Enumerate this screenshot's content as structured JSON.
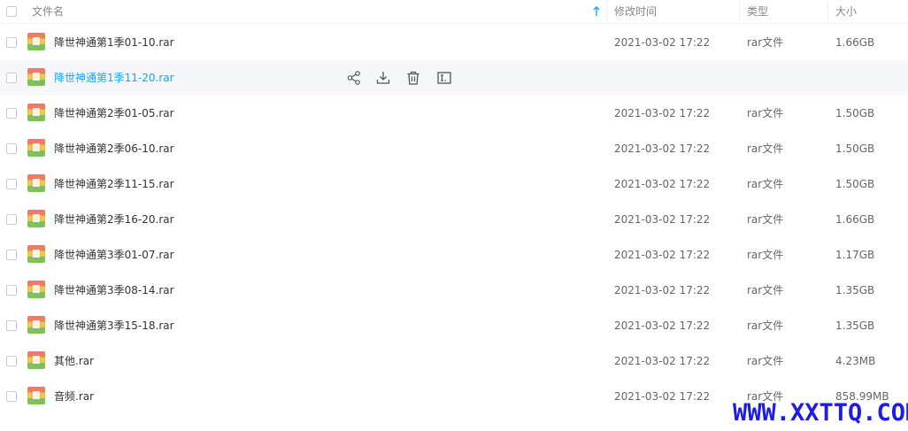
{
  "header": {
    "name_label": "文件名",
    "time_label": "修改时间",
    "type_label": "类型",
    "size_label": "大小",
    "sort_icon": "arrow-up-icon"
  },
  "files": [
    {
      "name": "降世神通第1季01-10.rar",
      "time": "2021-03-02 17:22",
      "type": "rar文件",
      "size": "1.66GB"
    },
    {
      "name": "降世神通第1季11-20.rar",
      "time": "",
      "type": "",
      "size": ""
    },
    {
      "name": "降世神通第2季01-05.rar",
      "time": "2021-03-02 17:22",
      "type": "rar文件",
      "size": "1.50GB"
    },
    {
      "name": "降世神通第2季06-10.rar",
      "time": "2021-03-02 17:22",
      "type": "rar文件",
      "size": "1.50GB"
    },
    {
      "name": "降世神通第2季11-15.rar",
      "time": "2021-03-02 17:22",
      "type": "rar文件",
      "size": "1.50GB"
    },
    {
      "name": "降世神通第2季16-20.rar",
      "time": "2021-03-02 17:22",
      "type": "rar文件",
      "size": "1.66GB"
    },
    {
      "name": "降世神通第3季01-07.rar",
      "time": "2021-03-02 17:22",
      "type": "rar文件",
      "size": "1.17GB"
    },
    {
      "name": "降世神通第3季08-14.rar",
      "time": "2021-03-02 17:22",
      "type": "rar文件",
      "size": "1.35GB"
    },
    {
      "name": "降世神通第3季15-18.rar",
      "time": "2021-03-02 17:22",
      "type": "rar文件",
      "size": "1.35GB"
    },
    {
      "name": "其他.rar",
      "time": "2021-03-02 17:22",
      "type": "rar文件",
      "size": "4.23MB"
    },
    {
      "name": "音频.rar",
      "time": "2021-03-02 17:22",
      "type": "rar文件",
      "size": "858.99MB"
    }
  ],
  "hover_actions": [
    "share-icon",
    "download-icon",
    "delete-icon",
    "rename-icon"
  ],
  "watermark": "WWW.XXTTQ.COM",
  "colors": {
    "accent": "#09aaff",
    "watermark": "#1d1be6",
    "hover_row": "#f5f7fa"
  }
}
